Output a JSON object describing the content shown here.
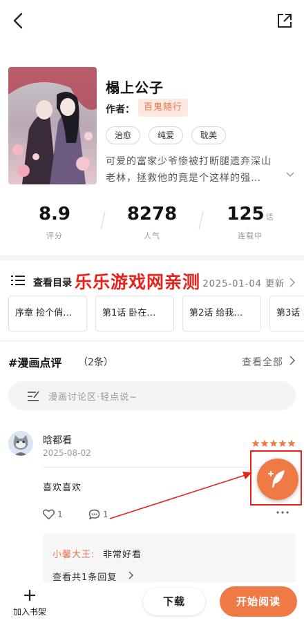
{
  "header": {
    "back_icon": "chevron-left-icon",
    "share_icon": "share-external-icon"
  },
  "book": {
    "title": "榻上公子",
    "author_label": "作者：",
    "author": "百鬼随行",
    "tags": [
      "治愈",
      "纯爱",
      "耽美"
    ],
    "description_line1": "可爱的富家少爷惨被打断腿遗弃深山",
    "description_line2": "老林，拯救他的竟是个这样的强…"
  },
  "stats": [
    {
      "value": "8.9",
      "unit": "",
      "label": "评分"
    },
    {
      "value": "8278",
      "unit": "",
      "label": "人气"
    },
    {
      "value": "125",
      "unit": "话",
      "label": "连载中"
    }
  ],
  "toc": {
    "label": "查看目录",
    "update_text": "2025-01-04 更新"
  },
  "watermark": "乐乐游戏网亲测",
  "chapters": [
    "序章 捡个俏…",
    "第1话 卧在…",
    "第2话 给我…",
    "第3话"
  ],
  "reviews": {
    "title": "#漫画点评",
    "count": "（2条）",
    "view_all": "查看全部",
    "input_placeholder": "漫画讨论区·轻点说~"
  },
  "comment": {
    "username": "晗都看",
    "date": "2025-08-02",
    "rating": 5,
    "text": "喜欢喜欢",
    "likes": "1",
    "replies": "1",
    "reply": {
      "author": "小馨大王:",
      "text": "非常好看",
      "more": "查看共1条回复"
    }
  },
  "bottom": {
    "shelf_label": "加入书架",
    "download_label": "下载",
    "read_label": "开始阅读"
  },
  "colors": {
    "accent": "#ef7a45",
    "annotation_red": "#e8221b"
  }
}
